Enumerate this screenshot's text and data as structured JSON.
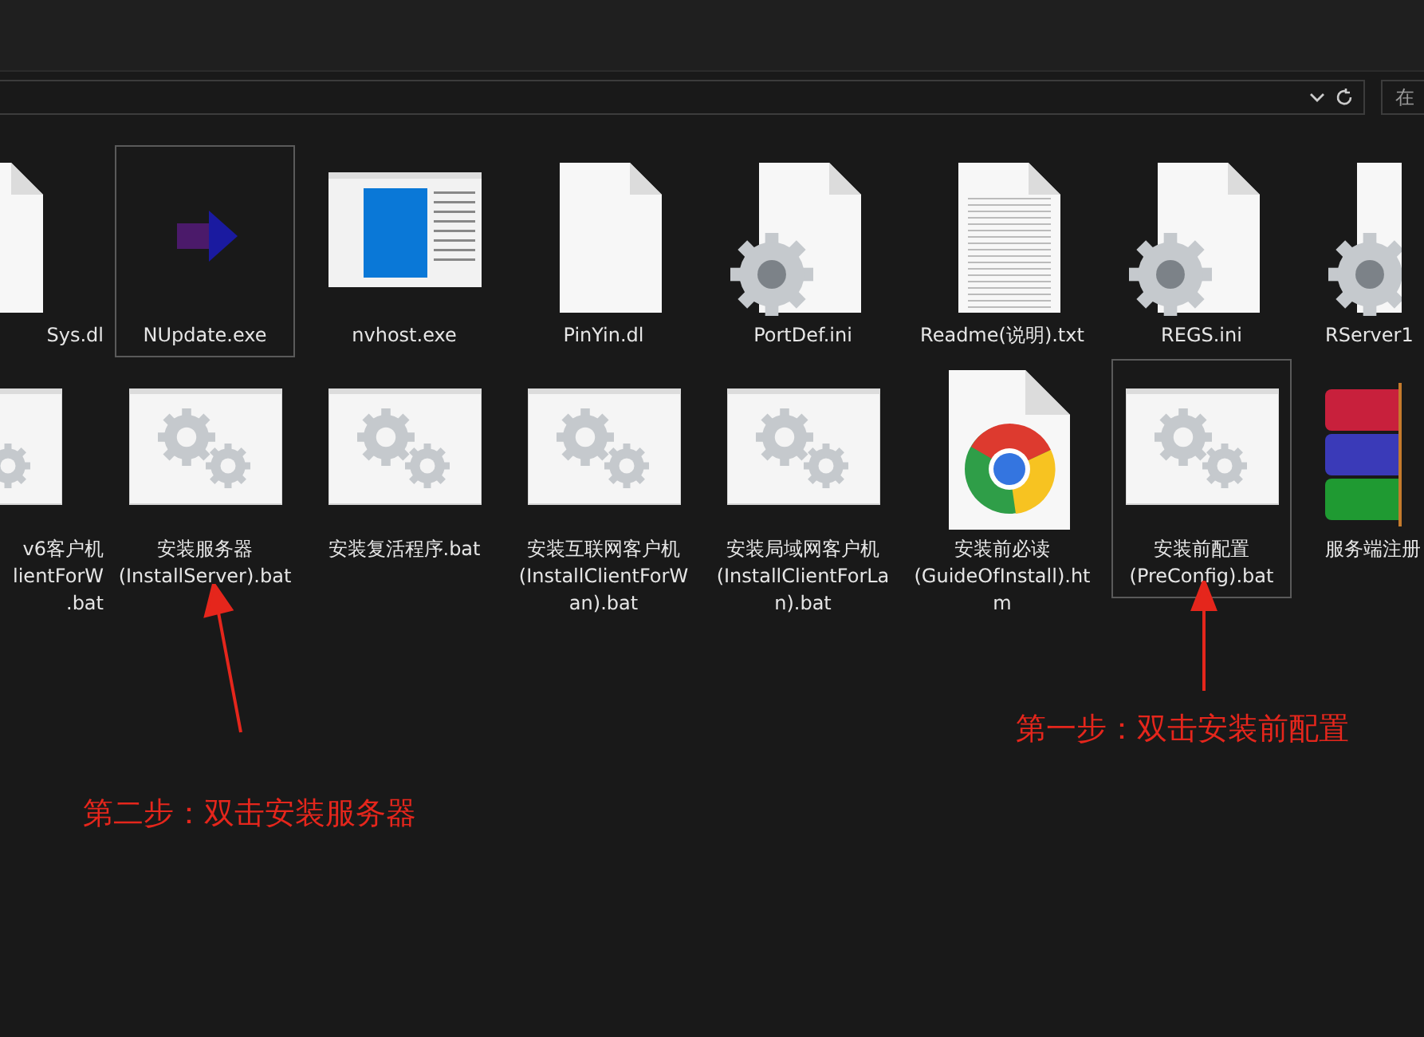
{
  "address_bar": {
    "search_placeholder": "在"
  },
  "rows": [
    [
      {
        "kind": "doc",
        "lines": [
          "Sys.dl"
        ],
        "selected": false,
        "cut_left": true
      },
      {
        "kind": "app",
        "lines": [
          "NUpdate.exe"
        ],
        "selected": true
      },
      {
        "kind": "window",
        "lines": [
          "nvhost.exe"
        ],
        "selected": false
      },
      {
        "kind": "doc",
        "lines": [
          "PinYin.dl"
        ],
        "selected": false
      },
      {
        "kind": "settings",
        "lines": [
          "PortDef.ini"
        ],
        "selected": false
      },
      {
        "kind": "text",
        "lines": [
          "Readme(说明).txt"
        ],
        "selected": false
      },
      {
        "kind": "settings",
        "lines": [
          "REGS.ini"
        ],
        "selected": false
      },
      {
        "kind": "settings",
        "lines": [
          "RServer1"
        ],
        "selected": false,
        "cut_right": true
      }
    ],
    [
      {
        "kind": "bat",
        "lines": [
          "v6客户机",
          "lientForW",
          ".bat"
        ],
        "selected": false,
        "cut_left": true
      },
      {
        "kind": "bat",
        "lines": [
          "安装服务器",
          "(InstallServer).bat"
        ],
        "selected": false
      },
      {
        "kind": "bat",
        "lines": [
          "安装复活程序.bat"
        ],
        "selected": false
      },
      {
        "kind": "bat",
        "lines": [
          "安装互联网客户机",
          "(InstallClientForW",
          "an).bat"
        ],
        "selected": false
      },
      {
        "kind": "bat",
        "lines": [
          "安装局域网客户机",
          "(InstallClientForLa",
          "n).bat"
        ],
        "selected": false
      },
      {
        "kind": "chrome",
        "lines": [
          "安装前必读",
          "(GuideOfInstall).ht",
          "m"
        ],
        "selected": false
      },
      {
        "kind": "bat",
        "lines": [
          "安装前配置",
          "(PreConfig).bat"
        ],
        "selected": true
      },
      {
        "kind": "archive",
        "lines": [
          "服务端注册"
        ],
        "selected": false,
        "cut_right": true
      }
    ]
  ],
  "annotations": [
    {
      "text": "第一步：双击安装前配置"
    },
    {
      "text": "第二步：双击安装服务器"
    }
  ]
}
